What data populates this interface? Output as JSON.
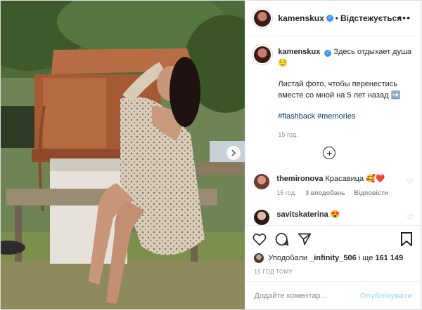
{
  "header": {
    "username": "kamenskux",
    "follow_status": "Відстежується",
    "more_icon": "more-horizontal-icon"
  },
  "caption": {
    "username": "kamenskux",
    "line1": "Здесь отдыхает душа 😌",
    "line2": "Листай фото, чтобы перенестись вместе со мной на 5 лет назад ➡️",
    "hashtags": "#flashback #memories",
    "time": "15 год."
  },
  "comments": [
    {
      "username": "themironova",
      "text": "Красавица 🥰❤️",
      "time": "15 год.",
      "likes": "3 вподобань",
      "reply": "Відповісти"
    },
    {
      "username": "savitskaterina",
      "text": "😍"
    }
  ],
  "likes": {
    "prefix": "Уподобали",
    "user": "_infinity_506",
    "middle": "і ще",
    "count": "161 149"
  },
  "time_ago": "15 ГОД ТОМУ",
  "comment_box": {
    "placeholder": "Додайте коментар...",
    "post_label": "Опублікувати"
  },
  "colors": {
    "verified": "#3897f0",
    "link": "#00376b",
    "post_disabled": "#b2dffc"
  }
}
